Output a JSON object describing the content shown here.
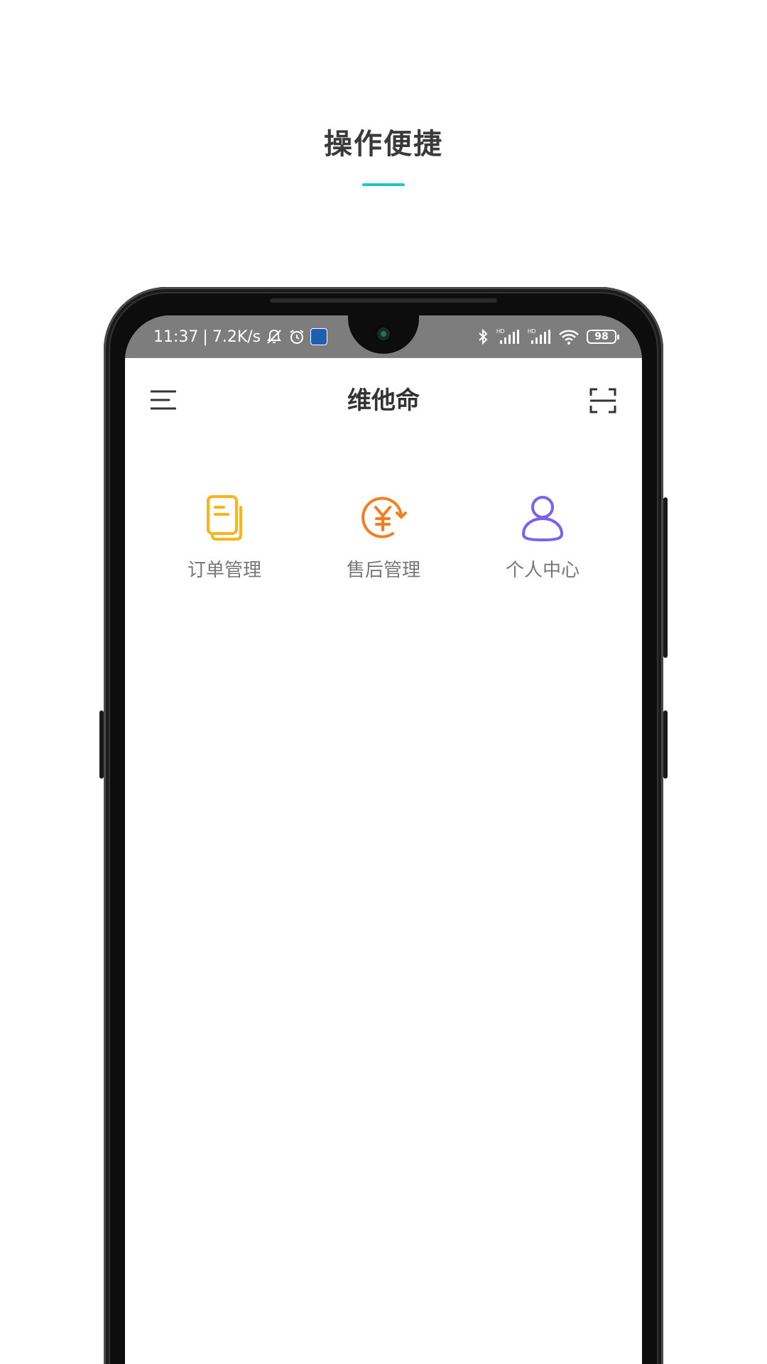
{
  "promo": {
    "title": "操作便捷",
    "accent_color": "#1cc8c0"
  },
  "status_bar": {
    "time": "11:37",
    "separator": "|",
    "net_speed": "7.2K/s",
    "left_icons": [
      "mute-notification-icon",
      "alarm-icon",
      "app-notification-icon"
    ],
    "right_icons": [
      "bluetooth-icon",
      "hd-signal-icon",
      "hd-signal-icon",
      "wifi-icon",
      "battery-icon"
    ],
    "battery_level": "98"
  },
  "app": {
    "title": "维他命",
    "menu_icon": "menu-icon",
    "scan_icon": "scan-icon"
  },
  "entries": [
    {
      "label": "订单管理",
      "icon": "order-document-icon",
      "color": "#f9b31b"
    },
    {
      "label": "售后管理",
      "icon": "yen-refund-icon",
      "color": "#f57c1f"
    },
    {
      "label": "个人中心",
      "icon": "person-icon",
      "color": "#7b61f0"
    }
  ]
}
